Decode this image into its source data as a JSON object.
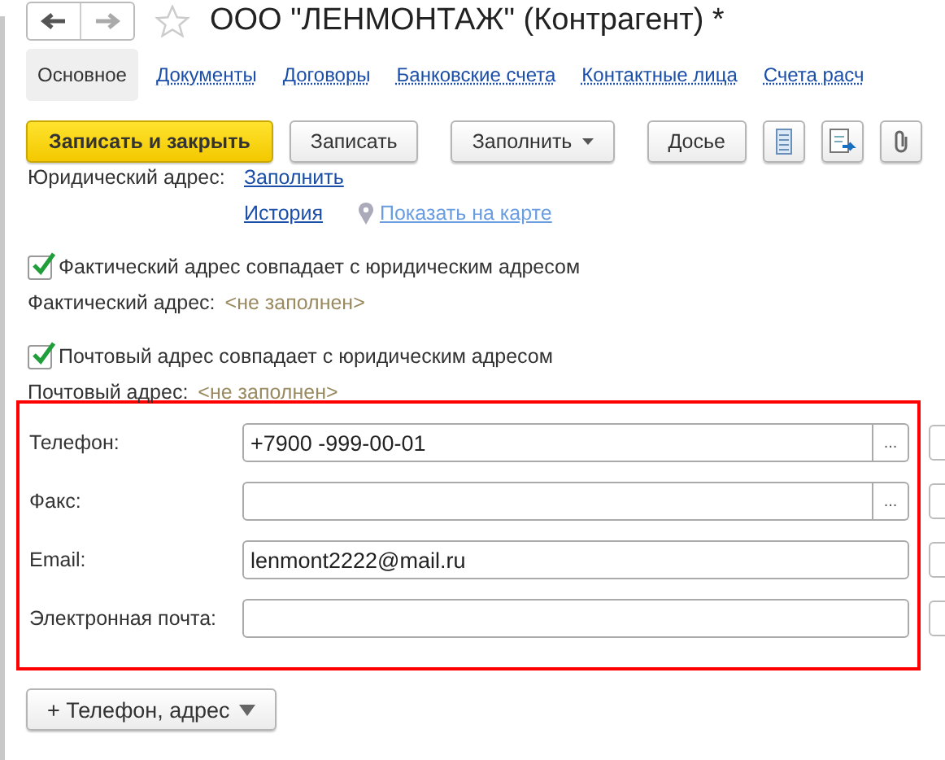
{
  "window": {
    "title": "ООО \"ЛЕНМОНТАЖ\" (Контрагент) *"
  },
  "tabs": [
    {
      "label": "Основное",
      "selected": true
    },
    {
      "label": "Документы",
      "selected": false
    },
    {
      "label": "Договоры",
      "selected": false
    },
    {
      "label": "Банковские счета",
      "selected": false
    },
    {
      "label": "Контактные лица",
      "selected": false
    },
    {
      "label": "Счета расч",
      "selected": false
    }
  ],
  "toolbar": [
    {
      "kind": "primary",
      "label": "Записать и закрыть"
    },
    {
      "kind": "plain",
      "label": "Записать"
    },
    {
      "kind": "dropdown",
      "label": "Заполнить"
    },
    {
      "kind": "plain",
      "label": "Досье"
    },
    {
      "kind": "list-icon"
    },
    {
      "kind": "report-icon"
    },
    {
      "kind": "clip-icon"
    }
  ],
  "legal_address": {
    "label": "Юридический адрес:",
    "fill_link": "Заполнить",
    "history_link": "История",
    "map_link": "Показать на карте"
  },
  "address_options": [
    {
      "checkbox": "Фактический адрес совпадает с юридическим адресом",
      "checked": true,
      "label": "Фактический адрес:",
      "value": "<не заполнен>"
    },
    {
      "checkbox": "Почтовый адрес совпадает с юридическим адресом",
      "checked": true,
      "label": "Почтовый адрес:",
      "value": "<не заполнен>"
    }
  ],
  "contacts": [
    {
      "label": "Телефон:",
      "value": "+7900 -999-00-01",
      "select_button": "..."
    },
    {
      "label": "Факс:",
      "select_button": "..."
    },
    {
      "label": "Email:",
      "value": "lenmont2222@mail.ru"
    },
    {
      "label": "Электронная почта:"
    }
  ],
  "add_button": {
    "label": "+ Телефон, адрес"
  }
}
